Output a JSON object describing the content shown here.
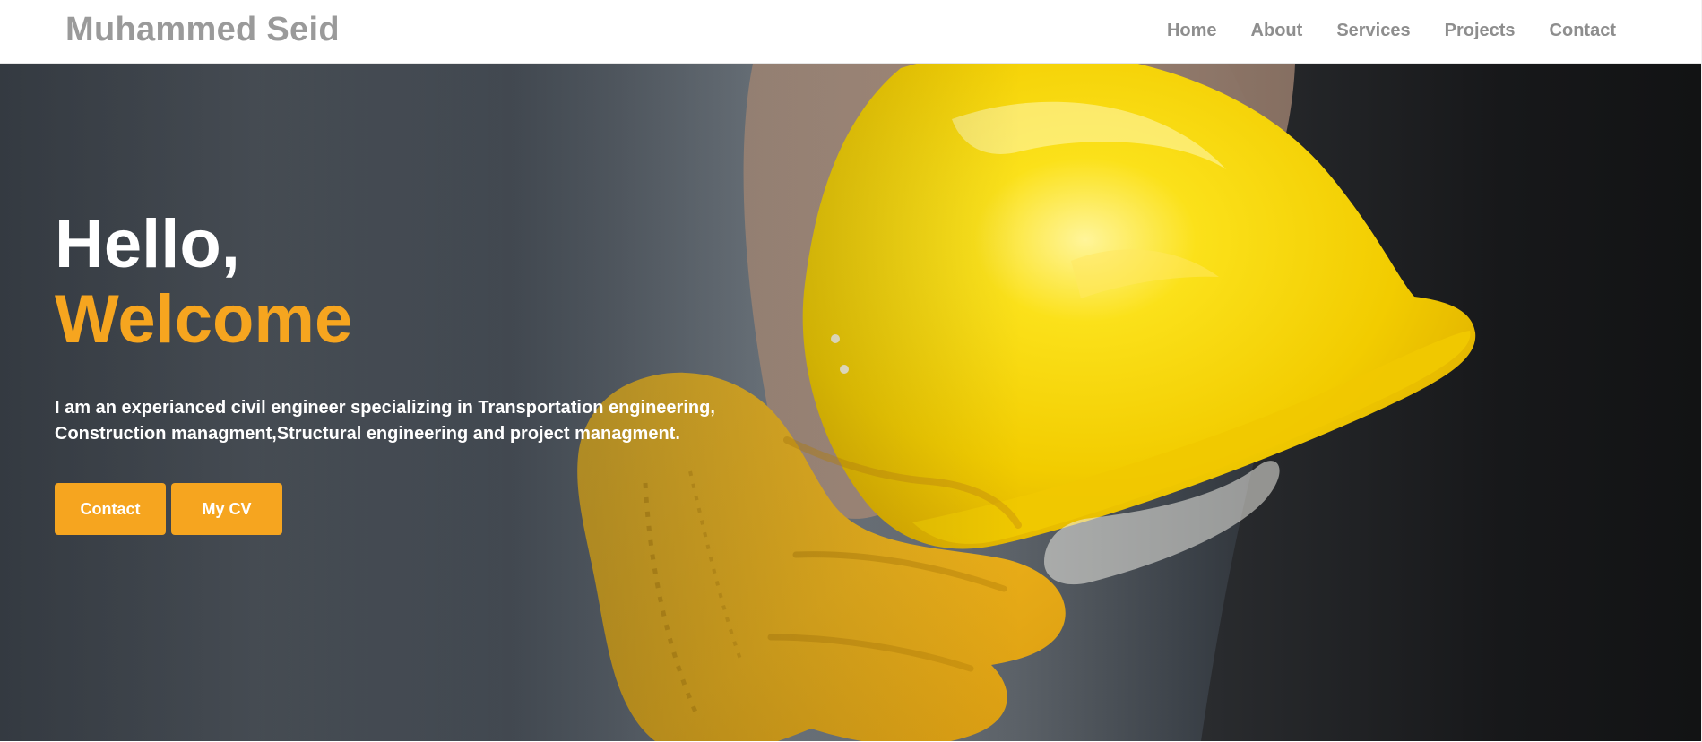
{
  "header": {
    "brand": "Muhammed Seid",
    "nav": [
      {
        "label": "Home"
      },
      {
        "label": "About"
      },
      {
        "label": "Services"
      },
      {
        "label": "Projects"
      },
      {
        "label": "Contact"
      }
    ]
  },
  "hero": {
    "title_line_1": "Hello,",
    "title_line_2": "Welcome",
    "text_line_1": "I am an experianced civil engineer specializing in Transportation engineering,",
    "text_line_2": "Construction managment,Structural engineering and project managment.",
    "buttons": [
      {
        "label": "Contact"
      },
      {
        "label": "My CV"
      }
    ],
    "image": {
      "subject": "hand in yellow work glove holding a yellow hard hat"
    }
  },
  "colors": {
    "accent": "#f6a51f",
    "nav_text": "#8e8e8e",
    "brand_text": "#9a9a9a",
    "hero_text": "#ffffff",
    "helmet_yellow": "#f4d400",
    "glove_yellow": "#f0b414"
  }
}
